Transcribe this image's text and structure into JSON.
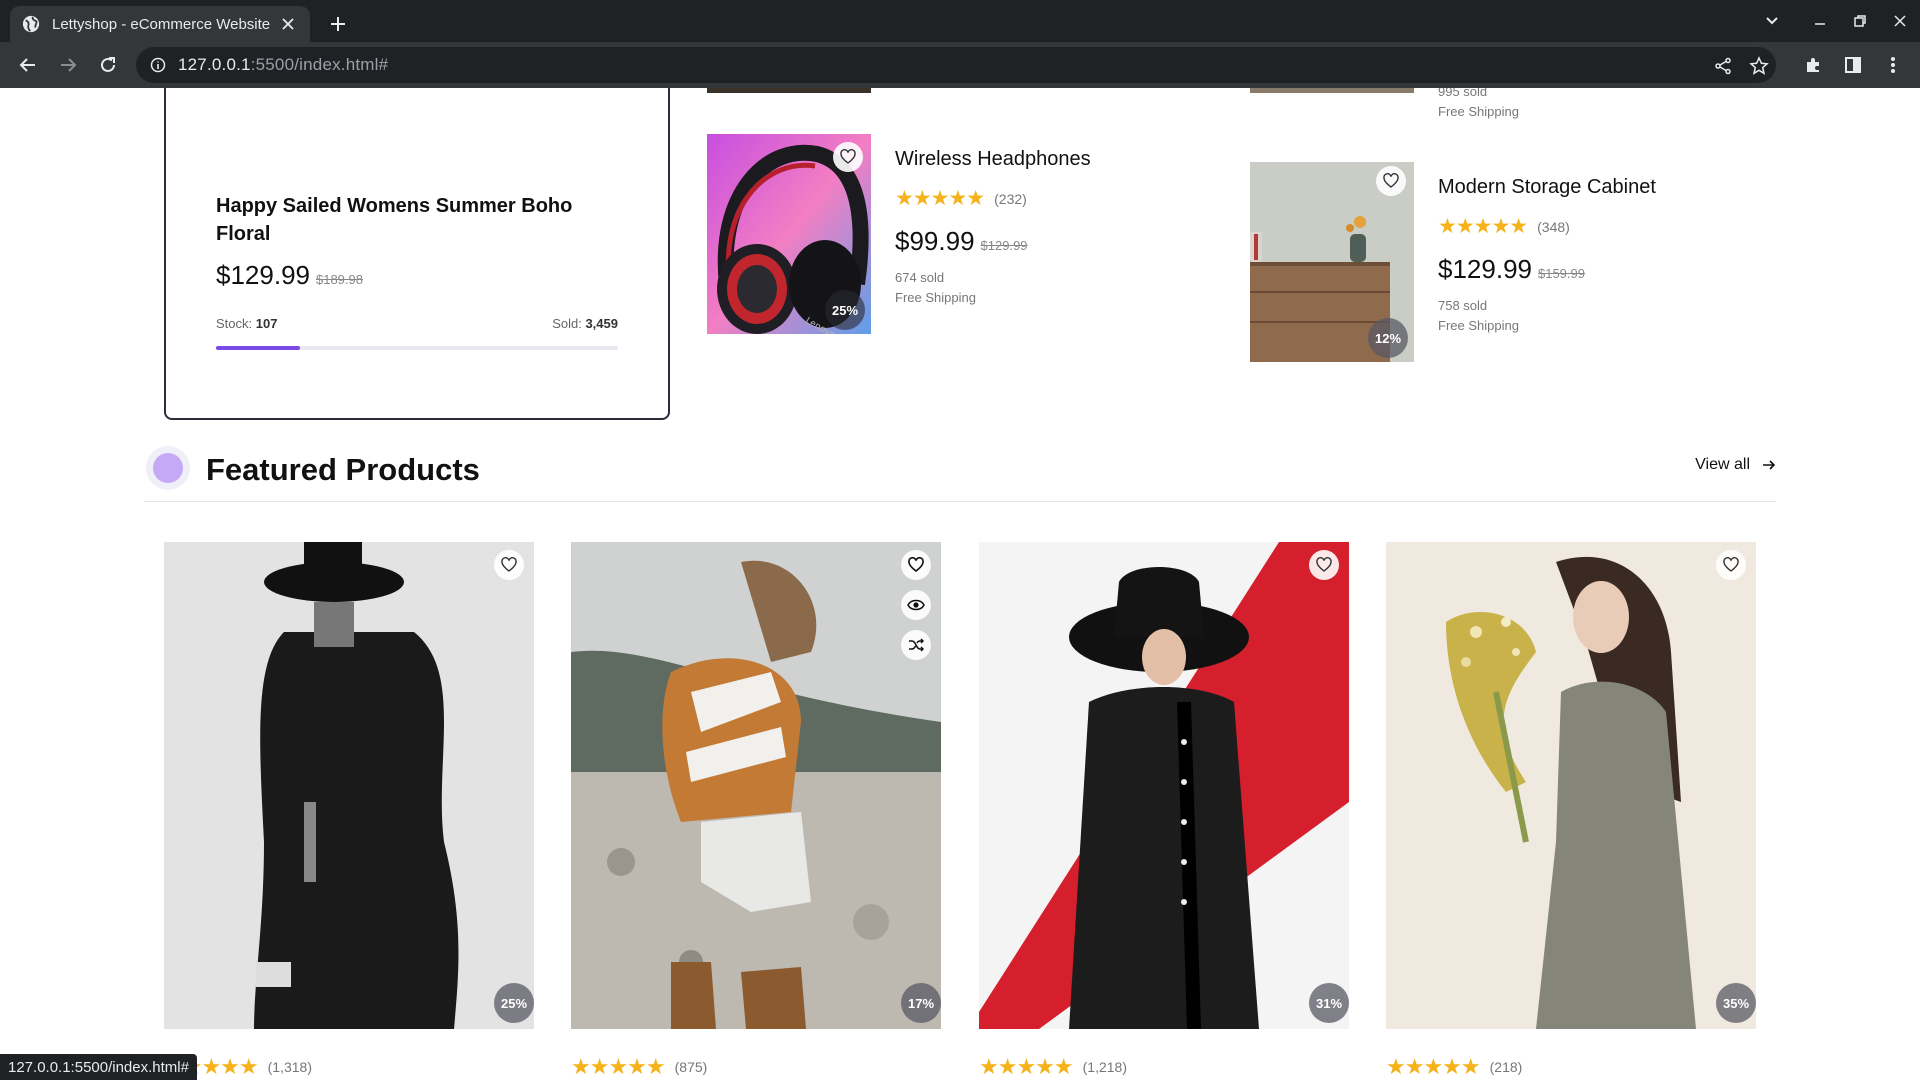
{
  "browser": {
    "tab_title": "Lettyshop - eCommerce Website",
    "url_host": "127.0.0.1",
    "url_rest": ":5500/index.html#",
    "status_url": "127.0.0.1:5500/index.html#"
  },
  "deal": {
    "title": "Happy Sailed Womens Summer Boho Floral",
    "price": "$129.99",
    "old_price": "$189.98",
    "stock_label": "Stock:",
    "stock_value": "107",
    "sold_label": "Sold:",
    "sold_value": "3,459",
    "sold_fraction": 0.21
  },
  "top_right_partial": {
    "sold": "995 sold",
    "shipping": "Free Shipping"
  },
  "mini_products": [
    {
      "name": "Wireless Headphones",
      "reviews": "(232)",
      "price": "$99.99",
      "old_price": "$129.99",
      "sold": "674 sold",
      "shipping": "Free Shipping",
      "discount": "25%"
    },
    {
      "name": "Modern Storage Cabinet",
      "reviews": "(348)",
      "price": "$129.99",
      "old_price": "$159.99",
      "sold": "758 sold",
      "shipping": "Free Shipping",
      "discount": "12%"
    }
  ],
  "featured": {
    "title": "Featured Products",
    "view_all": "View all",
    "products": [
      {
        "discount": "25%",
        "reviews": "(1,318)"
      },
      {
        "discount": "17%",
        "reviews": "(875)"
      },
      {
        "discount": "31%",
        "reviews": "(1,218)"
      },
      {
        "discount": "35%",
        "reviews": "(218)"
      }
    ]
  },
  "rating_stars": "★★★★★",
  "colors": {
    "accent": "#7b4be8",
    "star": "#f5b21a",
    "section_dot": "#c6a9f6"
  }
}
